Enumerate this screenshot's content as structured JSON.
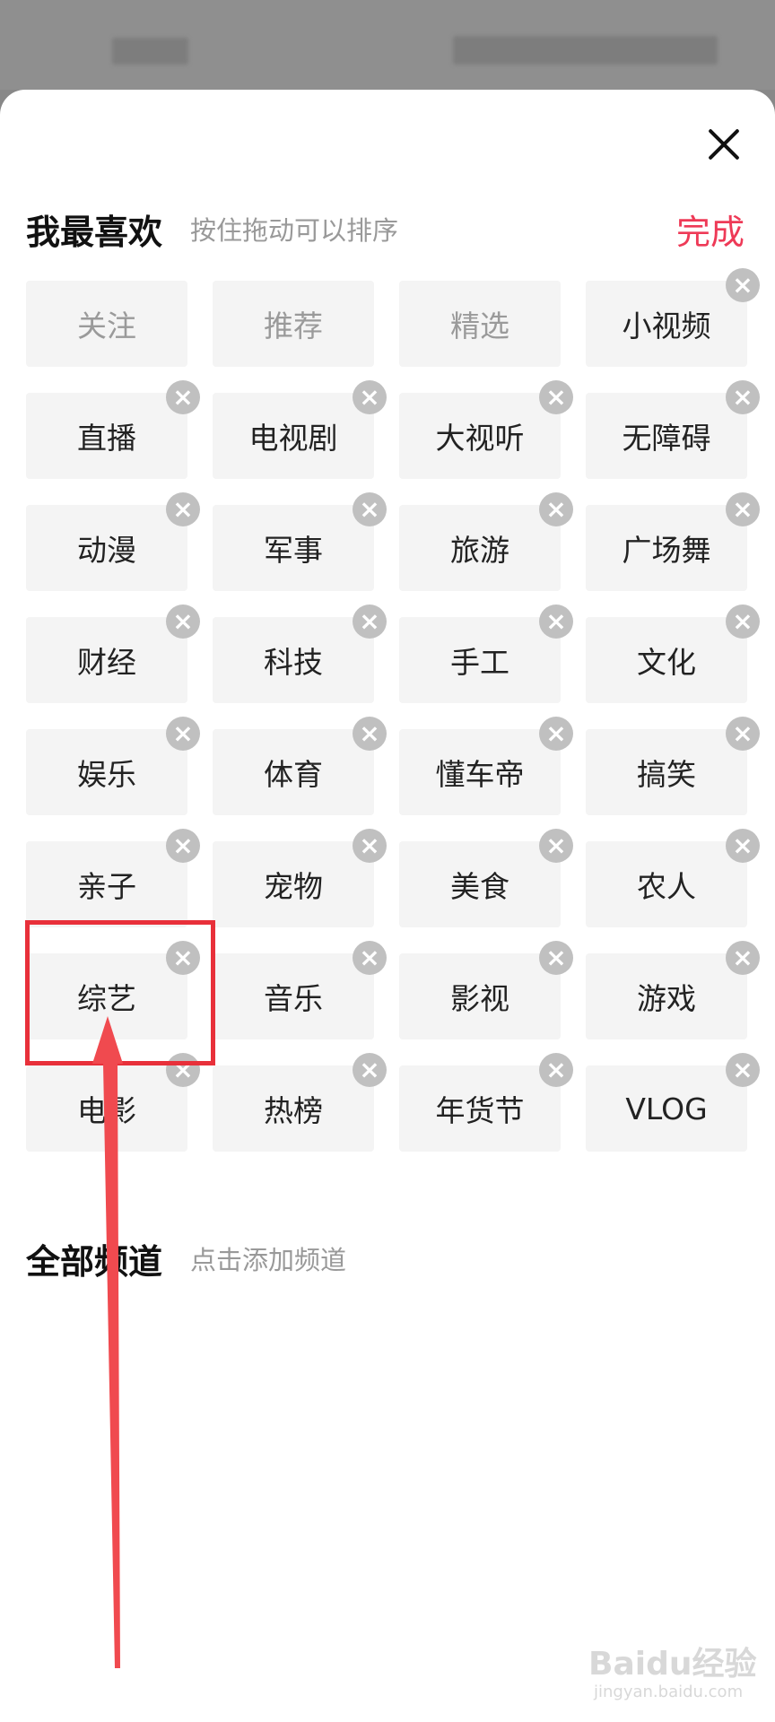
{
  "my_favorites": {
    "title": "我最喜欢",
    "hint": "按住拖动可以排序",
    "done_label": "完成",
    "channels": [
      {
        "label": "关注",
        "removable": false
      },
      {
        "label": "推荐",
        "removable": false
      },
      {
        "label": "精选",
        "removable": false
      },
      {
        "label": "小视频",
        "removable": true
      },
      {
        "label": "直播",
        "removable": true
      },
      {
        "label": "电视剧",
        "removable": true
      },
      {
        "label": "大视听",
        "removable": true
      },
      {
        "label": "无障碍",
        "removable": true
      },
      {
        "label": "动漫",
        "removable": true
      },
      {
        "label": "军事",
        "removable": true
      },
      {
        "label": "旅游",
        "removable": true
      },
      {
        "label": "广场舞",
        "removable": true
      },
      {
        "label": "财经",
        "removable": true
      },
      {
        "label": "科技",
        "removable": true
      },
      {
        "label": "手工",
        "removable": true
      },
      {
        "label": "文化",
        "removable": true
      },
      {
        "label": "娱乐",
        "removable": true
      },
      {
        "label": "体育",
        "removable": true
      },
      {
        "label": "懂车帝",
        "removable": true
      },
      {
        "label": "搞笑",
        "removable": true
      },
      {
        "label": "亲子",
        "removable": true
      },
      {
        "label": "宠物",
        "removable": true
      },
      {
        "label": "美食",
        "removable": true
      },
      {
        "label": "农人",
        "removable": true
      },
      {
        "label": "综艺",
        "removable": true
      },
      {
        "label": "音乐",
        "removable": true
      },
      {
        "label": "影视",
        "removable": true
      },
      {
        "label": "游戏",
        "removable": true
      },
      {
        "label": "电影",
        "removable": true
      },
      {
        "label": "热榜",
        "removable": true
      },
      {
        "label": "年货节",
        "removable": true
      },
      {
        "label": "VLOG",
        "removable": true
      }
    ]
  },
  "all_channels": {
    "title": "全部频道",
    "hint": "点击添加频道"
  },
  "watermark": {
    "brand": "Baidu经验",
    "url": "jingyan.baidu.com"
  },
  "icons": {
    "close": "close-icon",
    "remove": "remove-circle-icon",
    "annotation_arrow": "arrow-up-icon"
  },
  "colors": {
    "accent": "#ee3a57",
    "annotation": "#e8303a"
  }
}
